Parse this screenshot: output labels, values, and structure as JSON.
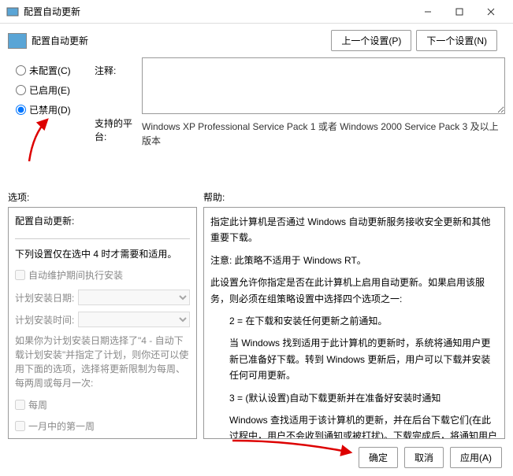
{
  "titlebar": {
    "title": "配置自动更新"
  },
  "subtitle": {
    "text": "配置自动更新"
  },
  "nav": {
    "prev": "上一个设置(P)",
    "next": "下一个设置(N)"
  },
  "radios": {
    "not_configured": "未配置(C)",
    "enabled": "已启用(E)",
    "disabled": "已禁用(D)"
  },
  "labels": {
    "comment": "注释:",
    "platform": "支持的平台:"
  },
  "platform_text": "Windows XP Professional Service Pack 1 或者 Windows 2000 Service Pack 3 及以上版本",
  "sections": {
    "options": "选项:",
    "help": "帮助:"
  },
  "options_panel": {
    "heading": "配置自动更新:",
    "note": "下列设置仅在选中 4 时才需要和适用。",
    "checkbox_auto_maint": "自动维护期间执行安装",
    "install_day_label": "计划安装日期:",
    "install_time_label": "计划安装时间:",
    "para_schedule": "如果你为计划安装日期选择了\"4 - 自动下载计划安装\"并指定了计划，则你还可以使用下面的选项，选择将更新限制为每周、每两周或每月一次:",
    "checkbox_weekly": "每周",
    "checkbox_first_week": "一月中的第一周"
  },
  "help_panel": {
    "p1": "指定此计算机是否通过 Windows 自动更新服务接收安全更新和其他重要下载。",
    "p2": "注意: 此策略不适用于 Windows RT。",
    "p3": "此设置允许你指定是否在此计算机上启用自动更新。如果启用该服务，则必须在组策略设置中选择四个选项之一:",
    "p4": "2 = 在下载和安装任何更新之前通知。",
    "p5": "当 Windows 找到适用于此计算机的更新时，系统将通知用户更新已准备好下载。转到 Windows 更新后，用户可以下载并安装任何可用更新。",
    "p6": "3 = (默认设置)自动下载更新并在准备好安装时通知",
    "p7": "Windows 查找适用于该计算机的更新，并在后台下载它们(在此过程中，用户不会收到通知或被打扰)。下载完成后，将通知用户更新已准备好进行安装。在转到 Windows 更新后，用户可以安装它们。"
  },
  "footer": {
    "ok": "确定",
    "cancel": "取消",
    "apply": "应用(A)"
  }
}
